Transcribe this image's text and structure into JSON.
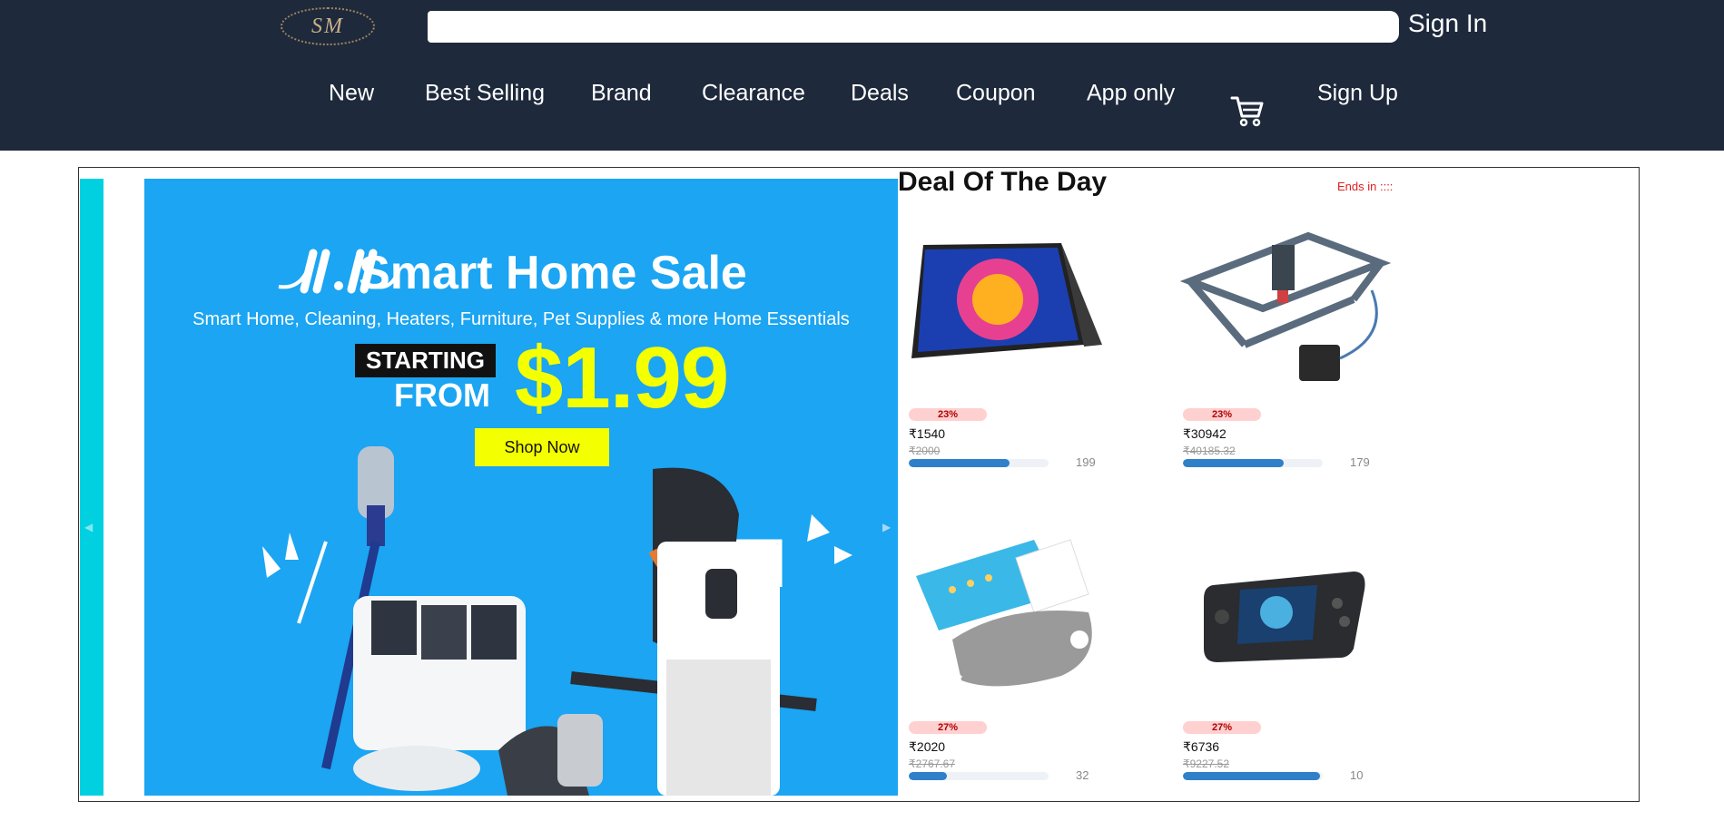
{
  "header": {
    "logo_text": "SM",
    "search": {
      "value": "",
      "placeholder": ""
    },
    "sign_in": "Sign In"
  },
  "nav": {
    "items": [
      "New",
      "Best Selling",
      "Brand",
      "Clearance",
      "Deals",
      "Coupon",
      "App only"
    ],
    "cart_icon": "cart-icon",
    "sign_up": "Sign Up"
  },
  "banner": {
    "title": "Smart Home Sale",
    "subtitle": "Smart Home, Cleaning, Heaters, Furniture, Pet Supplies & more Home Essentials",
    "starting": "STARTING",
    "from": "FROM",
    "price": "$1.99",
    "cta": "Shop Now",
    "prev_icon": "chevron-left-icon",
    "next_icon": "chevron-right-icon"
  },
  "deals": {
    "title": "Deal Of The Day",
    "ends_in": "Ends in ::::",
    "products": [
      {
        "image": "portable-monitor-image",
        "discount": "23%",
        "price": "₹1540",
        "original_price": "₹2000",
        "sold": "199",
        "progress": 0.72
      },
      {
        "image": "laser-engraver-image",
        "discount": "23%",
        "price": "₹30942",
        "original_price": "₹40185.32",
        "sold": "179",
        "progress": 0.72
      },
      {
        "image": "heating-pad-image",
        "discount": "27%",
        "price": "₹2020",
        "original_price": "₹2767.67",
        "sold": "32",
        "progress": 0.27
      },
      {
        "image": "handheld-console-image",
        "discount": "27%",
        "price": "₹6736",
        "original_price": "₹9227.52",
        "sold": "10",
        "progress": 0.98
      }
    ]
  },
  "colors": {
    "header_bg": "#1e293b",
    "banner_bg": "#1ba5f2",
    "accent_yellow": "#f4ff00",
    "teal": "#00d0e0",
    "progress": "#2f80c8",
    "badge_bg": "#ffd0d0",
    "ends_red": "#e02020"
  }
}
